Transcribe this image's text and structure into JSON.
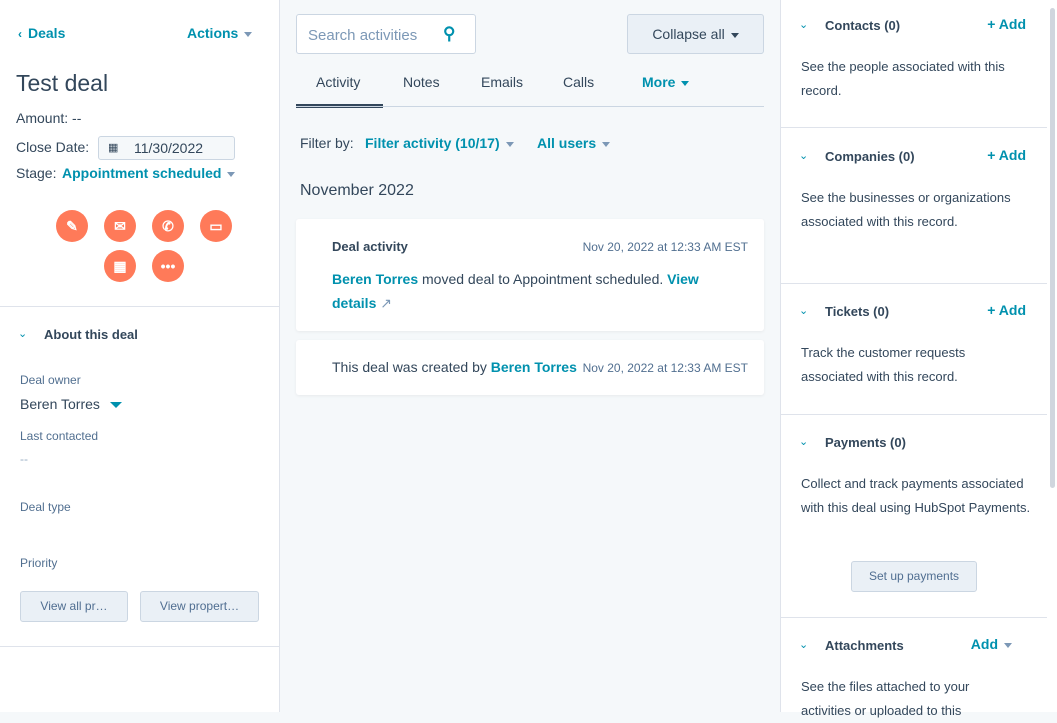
{
  "left": {
    "back": "Deals",
    "actions": "Actions",
    "title": "Test deal",
    "amount": "Amount: --",
    "close_label": "Close Date:",
    "close_value": "11/30/2022",
    "stage_label": "Stage:",
    "stage_value": "Appointment scheduled",
    "about": "About this deal",
    "owner_label": "Deal owner",
    "owner_value": "Beren Torres",
    "last_label": "Last contacted",
    "last_value": "--",
    "type_label": "Deal type",
    "priority_label": "Priority",
    "view_all": "View all pr…",
    "view_prop": "View propert…"
  },
  "mid": {
    "search_placeholder": "Search activities",
    "collapse": "Collapse all",
    "tabs": [
      "Activity",
      "Notes",
      "Emails",
      "Calls",
      "More"
    ],
    "filter_by": "Filter by:",
    "filter_activity": "Filter activity (10/17)",
    "all_users": "All users",
    "month": "November 2022",
    "card1": {
      "title": "Deal activity",
      "time": "Nov 20, 2022 at 12:33 AM EST",
      "user": "Beren Torres",
      "text": " moved deal to Appointment scheduled. ",
      "link": "View details"
    },
    "card2": {
      "text": "This deal was created by ",
      "user": "Beren Torres",
      "time": "Nov 20, 2022 at 12:33 AM EST"
    }
  },
  "right": {
    "sections": [
      {
        "title": "Contacts (0)",
        "action": "+ Add",
        "desc": "See the people associated with this record."
      },
      {
        "title": "Companies (0)",
        "action": "+ Add",
        "desc": "See the businesses or organizations associated with this record."
      },
      {
        "title": "Tickets (0)",
        "action": "+ Add",
        "desc": "Track the customer requests associated with this record."
      },
      {
        "title": "Payments (0)",
        "action": "",
        "desc": "Collect and track payments associated with this deal using HubSpot Payments.",
        "button": "Set up payments"
      },
      {
        "title": "Attachments",
        "action": "Add",
        "desc": "See the files attached to your activities or uploaded to this"
      }
    ]
  }
}
